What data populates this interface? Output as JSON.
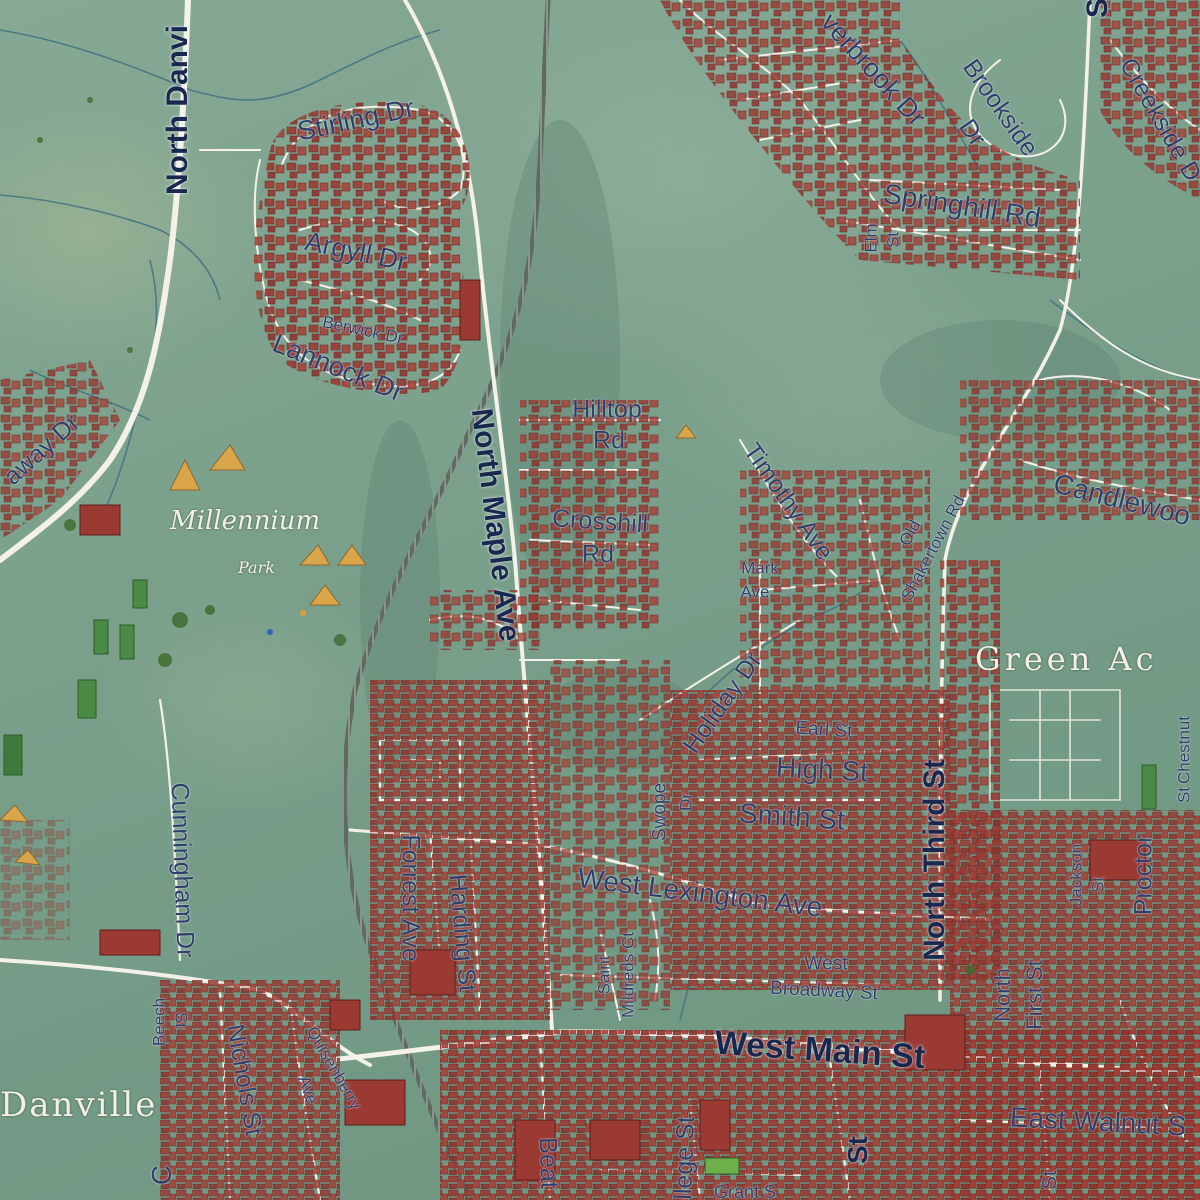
{
  "map": {
    "places": {
      "millennium": "Millennium",
      "park": "Park",
      "green_acres": "Green Ac",
      "danville": "Danville"
    },
    "roads": {
      "north_danville": "North Danvi",
      "stirling": "Stirling Dr",
      "argyll": "Argyll Dr",
      "berwick": "Berwick Dr",
      "lannock": "Lannock Dr",
      "hathaway": "away Dr",
      "north_maple": "North Maple Ave",
      "hilltop_1": "Hilltop",
      "hilltop_2": "Rd",
      "crosshill_1": "Crosshill",
      "crosshill_2": "Rd",
      "cunningham": "Cunningham Dr",
      "forrest": "Forrest Ave",
      "harding": "Harding St",
      "west_lexington": "West Lexington Ave",
      "saint_mildreds_1": "Saint",
      "saint_mildreds_2": "Mildreds Ct",
      "swope_1": "Swope",
      "swope_2": "Dr",
      "holiday": "Holiday Dr",
      "earl": "Earl St",
      "high": "High St",
      "smith": "Smith St",
      "timothy": "Timothy Ave",
      "mark_1": "Mark",
      "mark_2": "Ave",
      "old_shakertown_1": "Old",
      "old_shakertown_2": "Shakertown Rd",
      "north_third": "North Third St",
      "west_broadway_1": "West",
      "west_broadway_2": "Broadway St",
      "west_main": "West Main St",
      "east_walnut": "East Walnut S",
      "north_first_1": "North",
      "north_first_2": "First St",
      "jackson_1": "Jackson",
      "jackson_2": "St",
      "proctor": "Proctor",
      "chestnut_1": "Chestnut",
      "chestnut_2": "St",
      "overbrook": "verbrook Dr",
      "brookside_1": "Brookside",
      "brookside_2": "Dr",
      "creekside": "Creekside D",
      "springhill": "Springhill Rd",
      "elm_1": "Elm",
      "elm_2": "St",
      "candlewood": "Candlewoo",
      "top_s": "S",
      "beech_1": "Beech",
      "beech_2": "St",
      "nichols": "Nichols St",
      "quisenberry_1": "Quisenberry",
      "quisenberry_2": "Ave",
      "beat": "Beat",
      "college": "llege St",
      "n_st": "St",
      "grant_st": "Grant S",
      "e_st": "St",
      "bottom_c": "C"
    },
    "colors": {
      "terrain": "#7aa08c",
      "building": "#9a3a33",
      "road": "#f4f1e8",
      "water": "#3f6f7f",
      "ballfield": "#d9a548",
      "label": "#2e3f6a",
      "major_label": "#18284f"
    }
  }
}
